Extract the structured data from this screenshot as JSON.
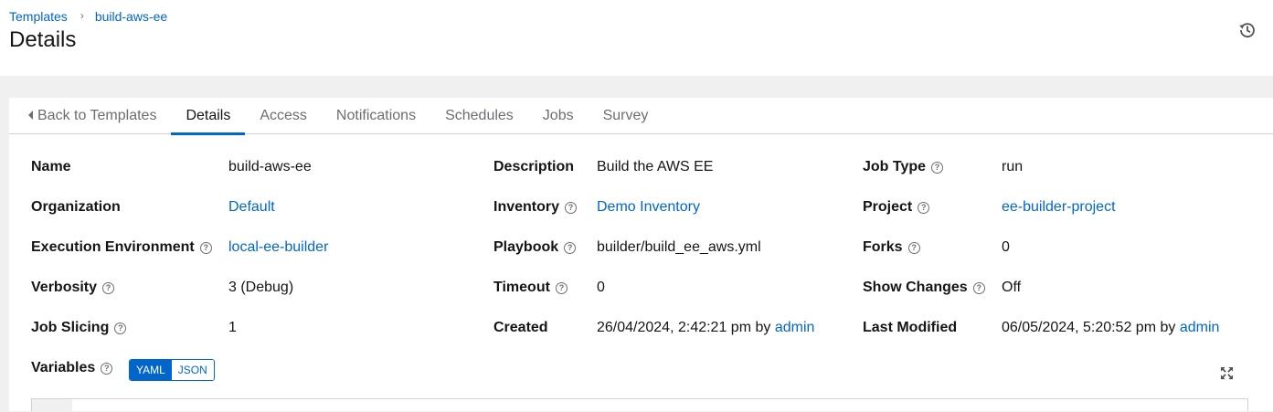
{
  "breadcrumb": {
    "parent": "Templates",
    "current": "build-aws-ee"
  },
  "page_title": "Details",
  "icons": {
    "history": "history-icon",
    "expand": "expand-icon",
    "help": "question-circle-icon"
  },
  "tabs": [
    {
      "label": "Back to Templates"
    },
    {
      "label": "Details"
    },
    {
      "label": "Access"
    },
    {
      "label": "Notifications"
    },
    {
      "label": "Schedules"
    },
    {
      "label": "Jobs"
    },
    {
      "label": "Survey"
    }
  ],
  "details": {
    "name": {
      "label": "Name",
      "value": "build-aws-ee"
    },
    "description": {
      "label": "Description",
      "value": "Build the AWS EE"
    },
    "job_type": {
      "label": "Job Type",
      "value": "run"
    },
    "organization": {
      "label": "Organization",
      "value": "Default"
    },
    "inventory": {
      "label": "Inventory",
      "value": "Demo Inventory"
    },
    "project": {
      "label": "Project",
      "value": "ee-builder-project"
    },
    "execution_environment": {
      "label": "Execution Environment",
      "value": "local-ee-builder"
    },
    "playbook": {
      "label": "Playbook",
      "value": "builder/build_ee_aws.yml"
    },
    "forks": {
      "label": "Forks",
      "value": "0"
    },
    "verbosity": {
      "label": "Verbosity",
      "value": "3 (Debug)"
    },
    "timeout": {
      "label": "Timeout",
      "value": "0"
    },
    "show_changes": {
      "label": "Show Changes",
      "value": "Off"
    },
    "job_slicing": {
      "label": "Job Slicing",
      "value": "1"
    },
    "created": {
      "label": "Created",
      "date": "26/04/2024, 2:42:21 pm",
      "by": "by",
      "user": "admin"
    },
    "last_modified": {
      "label": "Last Modified",
      "date": "06/05/2024, 5:20:52 pm",
      "by": "by",
      "user": "admin"
    },
    "variables": {
      "label": "Variables",
      "yaml": "YAML",
      "json": "JSON"
    }
  },
  "colors": {
    "link": "#0066cc",
    "active_tab_border": "#0066cc",
    "page_background": "#f0f0f0"
  }
}
